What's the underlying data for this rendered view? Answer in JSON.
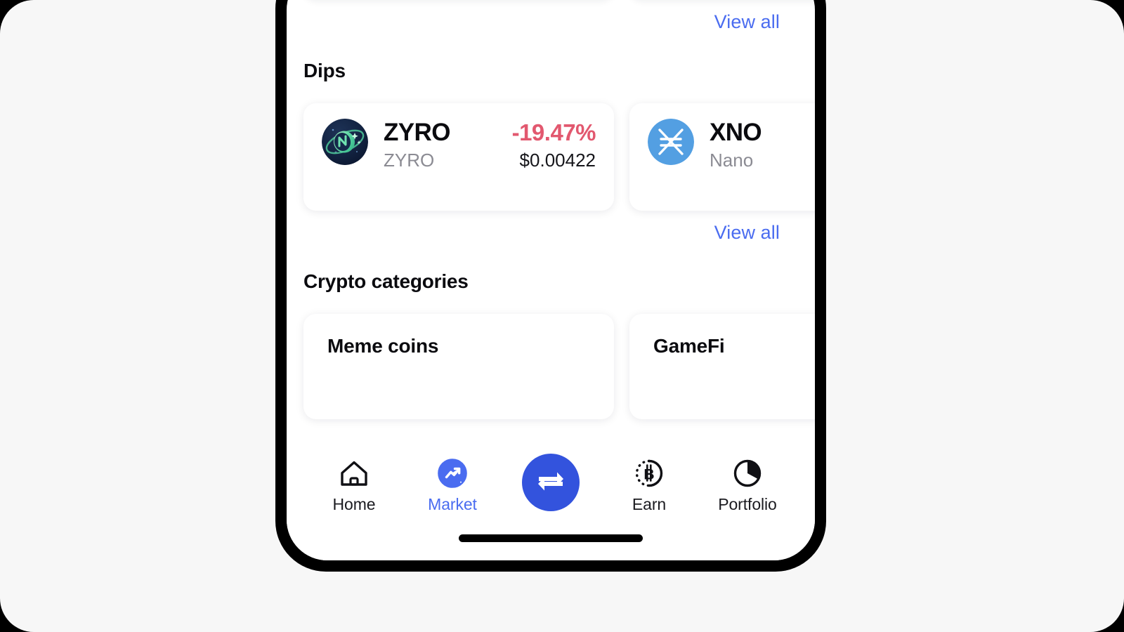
{
  "app": {
    "background_color": "#f7f7f7",
    "screen_background": "#ffffff",
    "accent_blue": "#4a6cf0",
    "swap_button_color": "#3353dd",
    "negative_color": "#e2586f"
  },
  "top_section": {
    "view_all_label": "View all"
  },
  "dips": {
    "title": "Dips",
    "view_all_label": "View all",
    "cards": [
      {
        "symbol": "ZYRO",
        "name": "ZYRO",
        "change": "-19.47%",
        "change_sign": "negative",
        "price": "$0.00422",
        "icon": "zyro-coin-icon"
      },
      {
        "symbol": "XNO",
        "name": "Nano",
        "change": "",
        "change_sign": "",
        "price": "",
        "icon": "nano-coin-icon"
      }
    ]
  },
  "crypto_categories": {
    "title": "Crypto categories",
    "cards": [
      {
        "title": "Meme coins"
      },
      {
        "title": "GameFi"
      }
    ]
  },
  "tabbar": {
    "items": [
      {
        "label": "Home",
        "icon": "home-icon",
        "active": false
      },
      {
        "label": "Market",
        "icon": "market-icon",
        "active": true
      },
      {
        "label": "",
        "icon": "swap-icon",
        "active": false
      },
      {
        "label": "Earn",
        "icon": "bitcoin-earn-icon",
        "active": false
      },
      {
        "label": "Portfolio",
        "icon": "pie-chart-icon",
        "active": false
      }
    ]
  }
}
